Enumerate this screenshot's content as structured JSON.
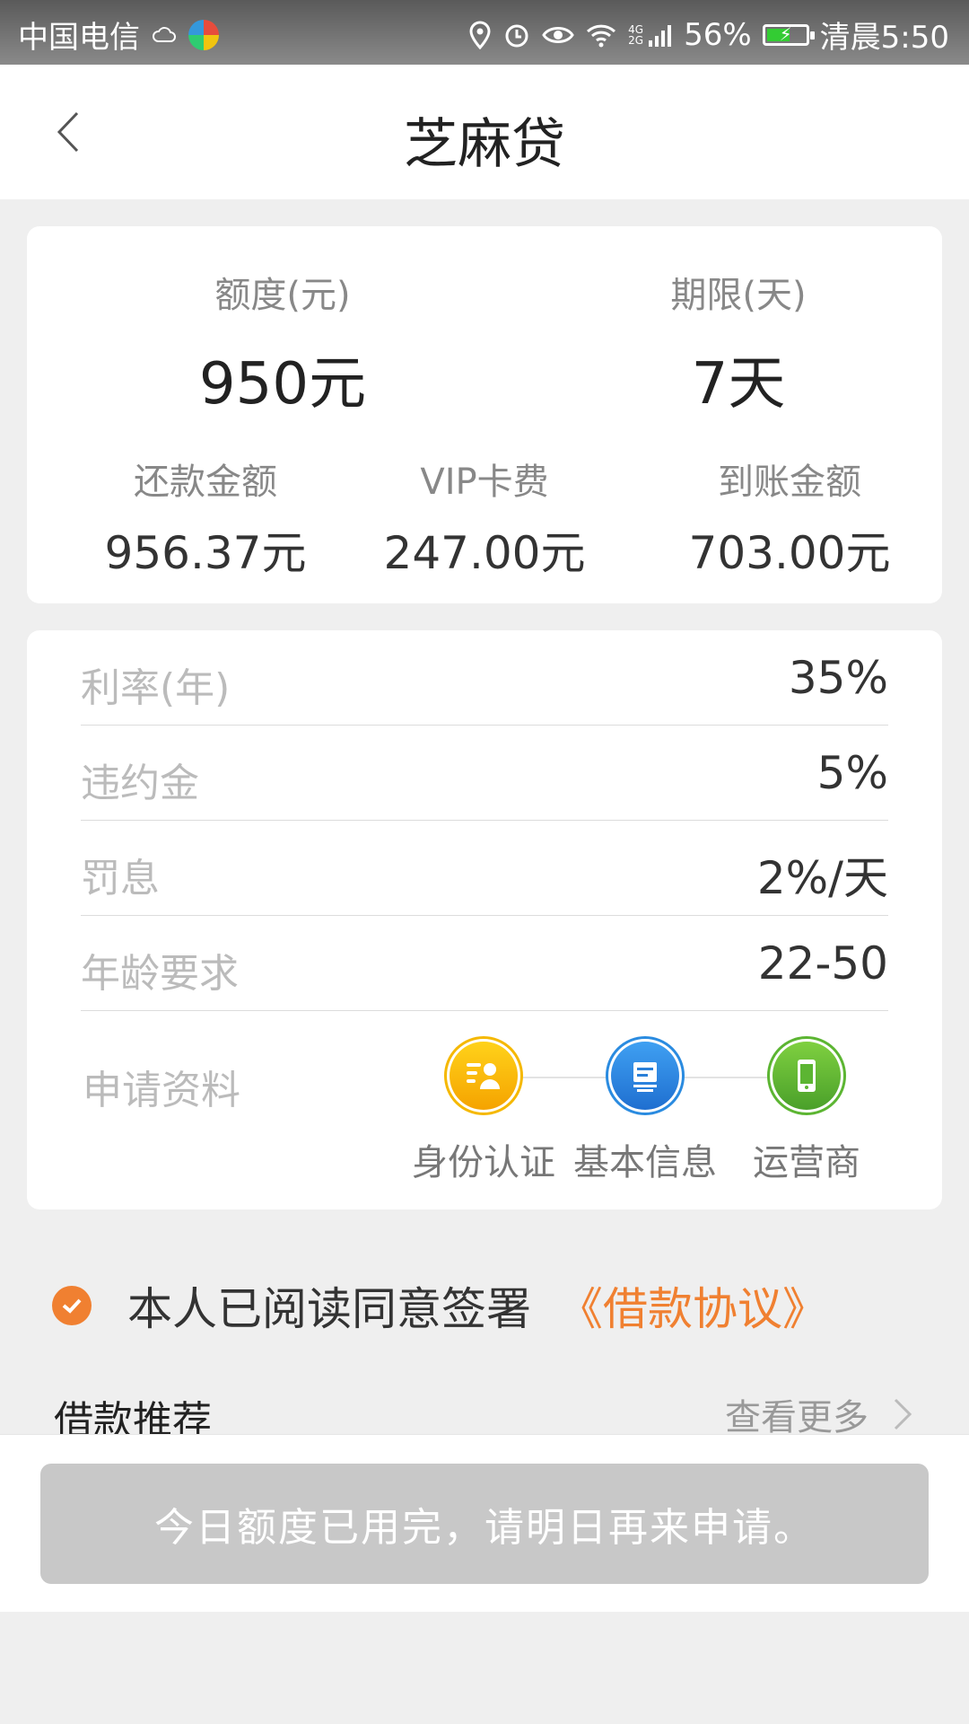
{
  "status_bar": {
    "carrier": "中国电信",
    "network": "4G 2G",
    "battery": "56%",
    "battery_level": 0.56,
    "time": "清晨5:50",
    "icons": [
      "weather-icon",
      "app-icon",
      "location-icon",
      "alarm-icon",
      "eye-icon",
      "wifi-icon",
      "signal-icon",
      "battery-icon"
    ]
  },
  "header": {
    "title": "芝麻贷"
  },
  "summary": {
    "limit_label": "额度(元)",
    "limit_value": "950元",
    "term_label": "期限(天)",
    "term_value": "7天",
    "repay_label": "还款金额",
    "repay_value": "956.37元",
    "vip_label": "VIP卡费",
    "vip_value": "247.00元",
    "received_label": "到账金额",
    "received_value": "703.00元"
  },
  "details": {
    "rows": [
      {
        "label": "利率(年)",
        "value": "35%"
      },
      {
        "label": "违约金",
        "value": "5%"
      },
      {
        "label": "罚息",
        "value": "2%/天"
      },
      {
        "label": "年龄要求",
        "value": "22-50"
      }
    ],
    "docs_label": "申请资料",
    "docs": [
      {
        "label": "身份认证",
        "icon": "id-card-icon",
        "color": "#f5b800"
      },
      {
        "label": "基本信息",
        "icon": "document-icon",
        "color": "#2a8be0"
      },
      {
        "label": "运营商",
        "icon": "phone-icon",
        "color": "#5cb532"
      }
    ]
  },
  "agreement": {
    "text": "本人已阅读同意签署",
    "link": "《借款协议》",
    "checked": true,
    "accent": "#f08031"
  },
  "recommend": {
    "title": "借款推荐",
    "more": "查看更多"
  },
  "apply": {
    "label": "今日额度已用完，请明日再来申请。"
  }
}
